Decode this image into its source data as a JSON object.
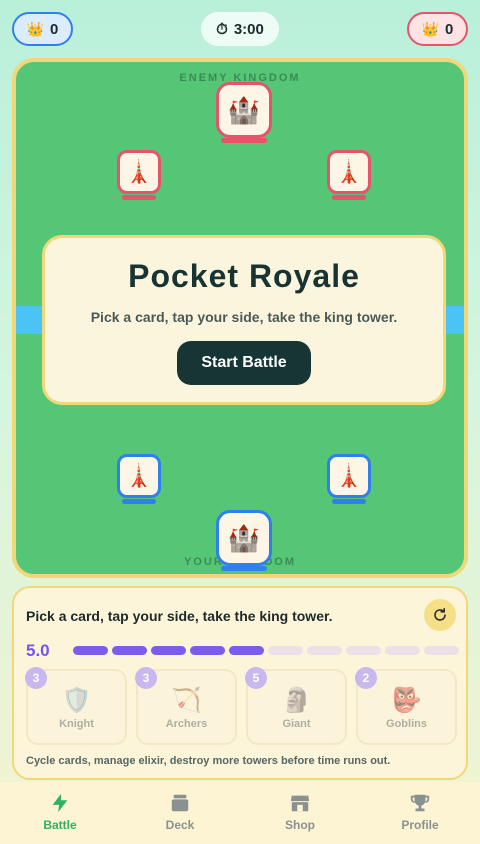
{
  "hud": {
    "player_crowns": "0",
    "enemy_crowns": "0",
    "timer": "3:00",
    "crown_icon": "👑",
    "timer_icon": "⏱"
  },
  "arena": {
    "enemy_label": "ENEMY KINGDOM",
    "ally_label": "YOUR KINGDOM",
    "king_icon": "🏰",
    "princess_icon": "🗼",
    "colors": {
      "enemy": "#e5546b",
      "ally": "#2f80ed",
      "grass": "#54c675",
      "river": "#4cc3f5"
    }
  },
  "modal": {
    "title": "Pocket Royale",
    "subtitle": "Pick a card, tap your side, take the king tower.",
    "start_label": "Start Battle"
  },
  "panel": {
    "message": "Pick a card, tap your side, take the king tower.",
    "elixir": "5.0",
    "elixir_filled": 5,
    "elixir_max": 10,
    "footer": "Cycle cards, manage elixir, destroy more towers before time runs out.",
    "cards": [
      {
        "cost": "3",
        "icon": "🛡️",
        "name": "Knight"
      },
      {
        "cost": "3",
        "icon": "🏹",
        "name": "Archers"
      },
      {
        "cost": "5",
        "icon": "🗿",
        "name": "Giant"
      },
      {
        "cost": "2",
        "icon": "👺",
        "name": "Goblins"
      }
    ]
  },
  "nav": {
    "items": [
      {
        "label": "Battle",
        "icon": "lightning-icon",
        "active": true
      },
      {
        "label": "Deck",
        "icon": "cards-icon",
        "active": false
      },
      {
        "label": "Shop",
        "icon": "shop-icon",
        "active": false
      },
      {
        "label": "Profile",
        "icon": "trophy-icon",
        "active": false
      }
    ]
  }
}
